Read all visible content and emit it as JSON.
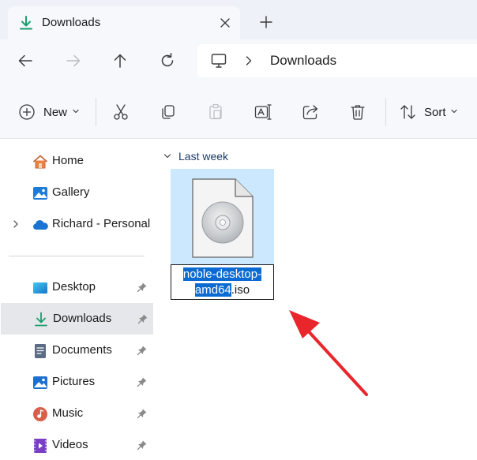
{
  "tab": {
    "title": "Downloads"
  },
  "address_bar": {
    "path_segment": "Downloads"
  },
  "toolbar": {
    "new_label": "New",
    "sort_label": "Sort"
  },
  "sidebar": {
    "items": [
      {
        "label": "Home"
      },
      {
        "label": "Gallery"
      },
      {
        "label": "Richard - Personal"
      },
      {
        "label": "Desktop"
      },
      {
        "label": "Downloads"
      },
      {
        "label": "Documents"
      },
      {
        "label": "Pictures"
      },
      {
        "label": "Music"
      },
      {
        "label": "Videos"
      }
    ]
  },
  "main": {
    "group_label": "Last week",
    "file": {
      "rename_selected_line1": "noble-desktop-",
      "rename_selected_line2": "amd64",
      "rename_extension": ".iso"
    }
  },
  "colors": {
    "selection_tile": "#cce8ff",
    "text_selection": "#0b6bd3",
    "annotation_arrow": "#e8262b",
    "accent_download": "#1c9c6c"
  }
}
